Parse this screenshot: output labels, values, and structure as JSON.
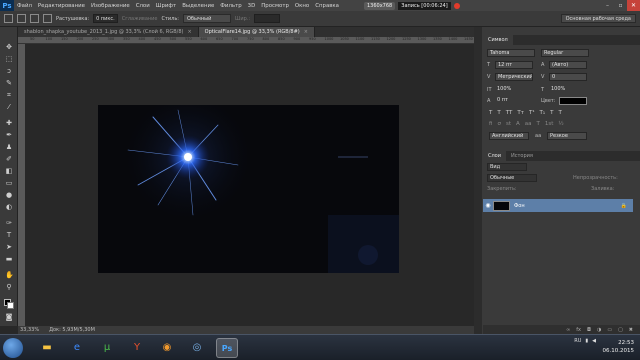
{
  "menubar": {
    "logo": "Ps",
    "items": [
      "Файл",
      "Редактирование",
      "Изображение",
      "Слои",
      "Шрифт",
      "Выделение",
      "Фильтр",
      "3D",
      "Просмотр",
      "Окно",
      "Справка"
    ]
  },
  "recording": {
    "resolution": "1360x768",
    "label": "Запись [00:06:24]"
  },
  "options_bar": {
    "feather_label": "Растушевка:",
    "feather_value": "0 пикс.",
    "smoothing_label": "Сглаживание",
    "style_label": "Стиль:",
    "style_value": "Обычный",
    "width_label": "Шир.:",
    "workspace": "Основная рабочая среда"
  },
  "tabs": [
    {
      "label": "shablon_shapka_youtube_2013_1.jpg @ 33,3% (Слой 6, RGB/8)",
      "active": false
    },
    {
      "label": "OpticalFlare14.jpg @ 33,3% (RGB/8#)",
      "active": true
    }
  ],
  "ruler": [
    "50",
    "100",
    "150",
    "200",
    "250",
    "300",
    "350",
    "400",
    "450",
    "500",
    "550",
    "600",
    "650",
    "700",
    "750",
    "800",
    "850",
    "900",
    "950",
    "1000",
    "1050",
    "1100",
    "1150",
    "1200",
    "1250",
    "1300",
    "1350",
    "1400",
    "1450"
  ],
  "status": {
    "zoom": "33,33%",
    "doc": "Док: 5,93M/5,30M"
  },
  "character": {
    "tabs": [
      "Символ"
    ],
    "font": "Tahoma",
    "style": "Regular",
    "size": "12 пт",
    "leading": "(Авто)",
    "kerning": "Метрический",
    "tracking": "0",
    "vscale": "100%",
    "hscale": "100%",
    "baseline": "0 пт",
    "color_label": "Цвет:",
    "glyphs": [
      "T",
      "T",
      "TT",
      "Tт",
      "T¹",
      "T₁",
      "T",
      "T"
    ],
    "glyphs2": [
      "fi",
      "σ",
      "st",
      "A",
      "aa",
      "T",
      "1st",
      "½"
    ],
    "language": "Английский",
    "aa": "Резкое",
    "aa_prefix": "aa"
  },
  "layers": {
    "tabs": [
      "Слои",
      "История"
    ],
    "filter_label": "Вид",
    "blend_mode": "Обычные",
    "opacity_label": "Непрозрачность:",
    "lock_label": "Закрепить:",
    "fill_label": "Заливка:",
    "layer_name": "Фон"
  },
  "taskbar": {
    "clock_time": "22:53",
    "clock_date": "06.10.2015",
    "lang": "RU"
  },
  "colors": {
    "flare_core": "#e8f2ff",
    "flare_blue": "#2e6cff",
    "selected_layer": "#5d7fa8"
  }
}
